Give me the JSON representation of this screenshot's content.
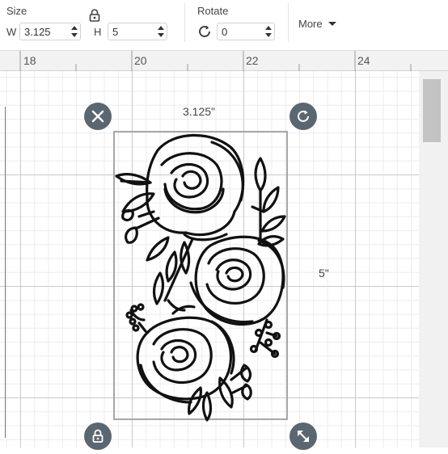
{
  "toolbar": {
    "size_label": "Size",
    "width_label": "W",
    "width_value": "3.125",
    "height_label": "H",
    "height_value": "5",
    "rotate_label": "Rotate",
    "rotate_value": "0",
    "more_label": "More"
  },
  "ruler": {
    "marks": [
      "18",
      "20",
      "22",
      "24"
    ]
  },
  "canvas": {
    "width_dimension": "3.125\"",
    "height_dimension": "5\""
  },
  "icons": {
    "lock": "lock-icon",
    "rotate": "rotate-icon",
    "delete": "close-icon",
    "rotate_handle": "rotate-icon",
    "lock_handle": "lock-icon",
    "scale_handle": "resize-diagonal-icon"
  },
  "colors": {
    "handle": "#5b6770",
    "design": "#111111",
    "grid_major": "#c9c9c9"
  }
}
